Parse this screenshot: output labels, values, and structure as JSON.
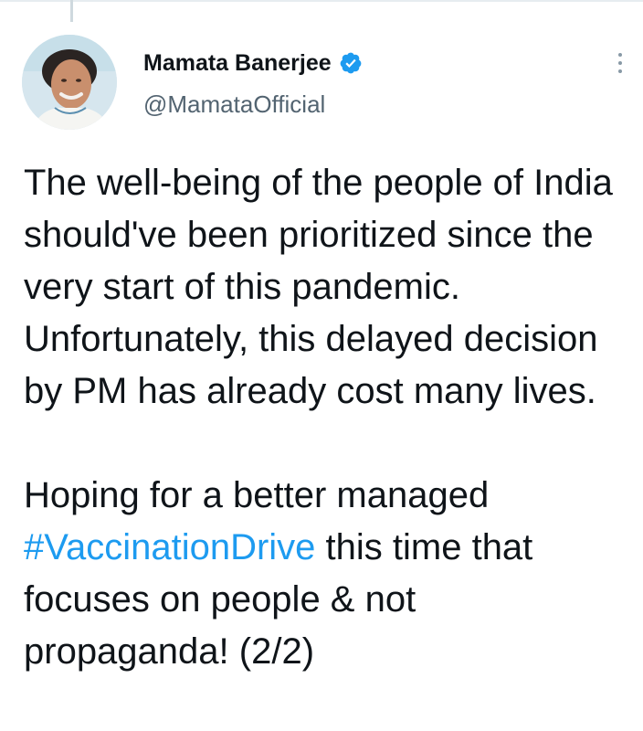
{
  "author": {
    "display_name": "Mamata Banerjee",
    "handle": "@MamataOfficial",
    "verified": true,
    "verified_icon": "verified-badge-icon",
    "avatar_icon": "profile-photo"
  },
  "menu": {
    "icon": "more-vertical-icon"
  },
  "tweet": {
    "paragraph1": "The well-being of the people of India should've been prioritized since the very start of this pandemic. Unfortunately, this delayed decision by PM has already cost many lives.",
    "paragraph2_before": "Hoping for a better managed ",
    "hashtag": "#VaccinationDrive",
    "paragraph2_after": " this time that focuses on people & not propaganda! (2/2)"
  },
  "colors": {
    "link": "#1d9bf0",
    "text": "#0f1419",
    "secondary": "#536471",
    "thread_line": "#cfd9de"
  }
}
